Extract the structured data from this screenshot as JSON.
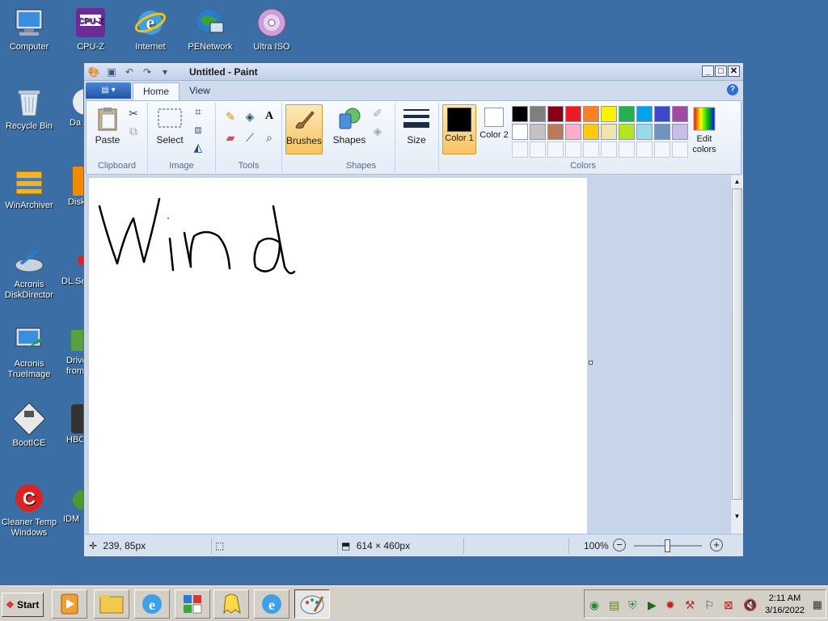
{
  "desktop": {
    "icons": [
      {
        "label": "Computer"
      },
      {
        "label": "CPU-Z"
      },
      {
        "label": "Internet"
      },
      {
        "label": "PENetwork"
      },
      {
        "label": "Ultra ISO"
      },
      {
        "label": "Recycle Bin"
      },
      {
        "label": "Da"
      },
      {
        "label": "WinArchiver"
      },
      {
        "label": "Disk"
      },
      {
        "label": "Acronis DiskDirector"
      },
      {
        "label": "DL.Se"
      },
      {
        "label": "Acronis TrueImage"
      },
      {
        "label": "Drive from"
      },
      {
        "label": "BootICE"
      },
      {
        "label": "HBC"
      },
      {
        "label": "Cleaner Temp Windows"
      },
      {
        "label": "IDM"
      }
    ]
  },
  "window": {
    "title": "Untitled - Paint",
    "controls": {
      "minimize": "_",
      "maximize": "□",
      "close": "✕"
    }
  },
  "tabs": [
    "Home",
    "View"
  ],
  "ribbon": {
    "clipboard": {
      "label": "Clipboard",
      "paste": "Paste"
    },
    "image": {
      "label": "Image",
      "select": "Select"
    },
    "tools": {
      "label": "Tools"
    },
    "brushes": {
      "label": "Brushes"
    },
    "shapes": {
      "label": "Shapes",
      "shapes_btn": "Shapes"
    },
    "size": {
      "label": "Size"
    },
    "colors": {
      "label": "Colors",
      "color1": "Color 1",
      "color2": "Color 2",
      "edit": "Edit colors",
      "color1_value": "#000000",
      "color2_value": "#ffffff",
      "palette_row1": [
        "#000000",
        "#7f7f7f",
        "#880015",
        "#ed1c24",
        "#ff7f27",
        "#fff200",
        "#22b14c",
        "#00a2e8",
        "#3f48cc",
        "#a349a4"
      ],
      "palette_row2": [
        "#ffffff",
        "#c3c3c3",
        "#b97a57",
        "#ffaec9",
        "#ffc90e",
        "#efe4b0",
        "#b5e61d",
        "#99d9ea",
        "#7092be",
        "#c8bfe7"
      ]
    }
  },
  "status": {
    "cursor_pos": "239, 85px",
    "selection": "",
    "image_size": "614 × 460px",
    "zoom": "100%"
  },
  "taskbar": {
    "start": "Start",
    "time": "2:11 AM",
    "date": "3/16/2022"
  }
}
